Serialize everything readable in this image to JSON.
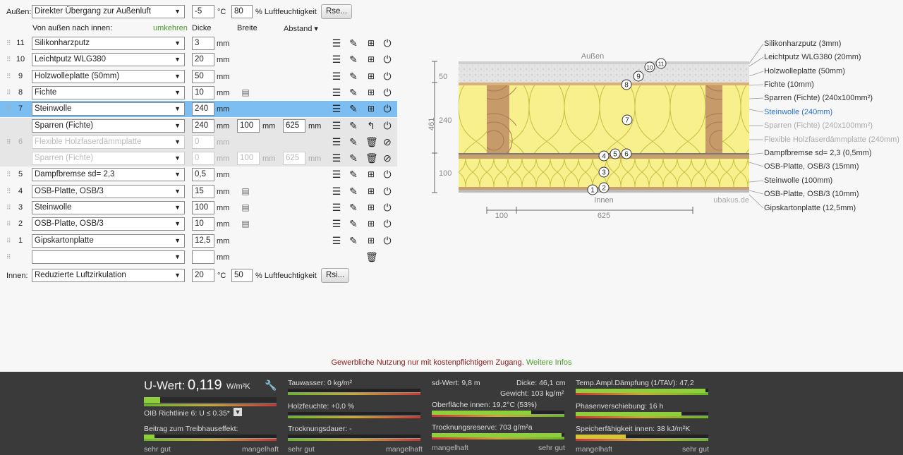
{
  "outside": {
    "label": "Außen:",
    "condition": "Direkter Übergang zur Außenluft",
    "temp": "-5",
    "temp_unit": "°C",
    "humidity": "80",
    "humidity_unit": "% Luftfeuchtigkeit",
    "rse_button": "Rse..."
  },
  "header": {
    "order_label": "Von außen nach innen:",
    "reverse_link": "umkehren",
    "col_thickness": "Dicke",
    "col_width": "Breite",
    "col_distance": "Abstand ▾"
  },
  "layers": [
    {
      "n": "11",
      "name": "Silikonharzputz",
      "d": "3",
      "unit": "mm"
    },
    {
      "n": "10",
      "name": "Leichtputz WLG380",
      "d": "20",
      "unit": "mm"
    },
    {
      "n": "9",
      "name": "Holzwolleplatte (50mm)",
      "d": "50",
      "unit": "mm"
    },
    {
      "n": "8",
      "name": "Fichte",
      "d": "10",
      "unit": "mm"
    },
    {
      "n": "7",
      "name": "Steinwolle",
      "d": "240",
      "unit": "mm"
    },
    {
      "n": "",
      "name": "Sparren (Fichte)",
      "d": "240",
      "unit": "mm",
      "w": "100",
      "wu": "mm",
      "a": "625",
      "au": "mm"
    },
    {
      "n": "6",
      "name": "Flexible Holzfaserdämmplatte",
      "d": "0",
      "unit": "mm"
    },
    {
      "n": "",
      "name": "Sparren (Fichte)",
      "d": "0",
      "unit": "mm",
      "w": "100",
      "wu": "mm",
      "a": "625",
      "au": "mm"
    },
    {
      "n": "5",
      "name": "Dampfbremse sd= 2,3",
      "d": "0,5",
      "unit": "mm"
    },
    {
      "n": "4",
      "name": "OSB-Platte, OSB/3",
      "d": "15",
      "unit": "mm"
    },
    {
      "n": "3",
      "name": "Steinwolle",
      "d": "100",
      "unit": "mm"
    },
    {
      "n": "2",
      "name": "OSB-Platte, OSB/3",
      "d": "10",
      "unit": "mm"
    },
    {
      "n": "1",
      "name": "Gipskartonplatte",
      "d": "12,5",
      "unit": "mm"
    },
    {
      "n": "",
      "name": "",
      "d": "",
      "unit": "mm"
    }
  ],
  "inside": {
    "label": "Innen:",
    "condition": "Reduzierte Luftzirkulation",
    "temp": "20",
    "temp_unit": "°C",
    "humidity": "50",
    "humidity_unit": "% Luftfeuchtigkeit",
    "rsi_button": "Rsi..."
  },
  "drawing": {
    "outside_label": "Außen",
    "inside_label": "Innen",
    "watermark": "ubakus.de",
    "dim_total": "461",
    "dim_top": "50",
    "dim_mid": "240",
    "dim_bot": "100",
    "dim_w1": "100",
    "dim_w2": "625",
    "legend": [
      {
        "text": "Silikonharzputz (3mm)",
        "style": "normal"
      },
      {
        "text": "Leichtputz WLG380 (20mm)",
        "style": "normal"
      },
      {
        "text": "Holzwolleplatte (50mm)",
        "style": "normal"
      },
      {
        "text": "Fichte (10mm)",
        "style": "normal"
      },
      {
        "text": "Sparren (Fichte) (240x100mm²)",
        "style": "normal"
      },
      {
        "text": "Steinwolle (240mm)",
        "style": "active"
      },
      {
        "text": "Sparren (Fichte) (240x100mm²)",
        "style": "disabled"
      },
      {
        "text": "Flexible Holzfaserdämmplatte (240mm)",
        "style": "disabled"
      },
      {
        "text": "Dampfbremse sd= 2,3 (0,5mm)",
        "style": "normal"
      },
      {
        "text": "OSB-Platte, OSB/3 (15mm)",
        "style": "normal"
      },
      {
        "text": "Steinwolle (100mm)",
        "style": "normal"
      },
      {
        "text": "OSB-Platte, OSB/3 (10mm)",
        "style": "normal"
      },
      {
        "text": "Gipskartonplatte (12,5mm)",
        "style": "normal"
      }
    ]
  },
  "notice": {
    "text": "Gewerbliche Nutzung nur mit kostenpflichtigem Zugang.",
    "link": "Weitere Infos"
  },
  "results": {
    "uwert_label": "U-Wert:",
    "uwert_value": "0,119",
    "uwert_unit": "W/m²K",
    "oib": "OIB Richtlinie 6: U ≤ 0.35*",
    "treibhaus": "Beitrag zum Treibhauseffekt:",
    "tauwasser": "Tauwasser: 0 kg/m²",
    "holzfeuchte": "Holzfeuchte: +0,0 %",
    "trocknung": "Trocknungsdauer: -",
    "sdwert": "sd-Wert: 9,8 m",
    "dicke": "Dicke: 46,1 cm",
    "gewicht": "Gewicht: 103 kg/m²",
    "oberflaeche": "Oberfläche innen: 19,2°C (53%)",
    "reserve": "Trocknungsreserve: 703 g/m²a",
    "tav": "Temp.Ampl.Dämpfung (1/TAV): 47,2",
    "phase": "Phasenverschiebung: 16 h",
    "speicher": "Speicherfähigkeit innen: 38 kJ/m²K",
    "good": "sehr gut",
    "bad": "mangelhaft",
    "levels": {
      "uwert": 0.12,
      "treibhaus": 0.08,
      "oberflaeche": 0.75,
      "reserve": 0.98,
      "tav": 0.98,
      "phase": 0.8,
      "speicher": 0.38
    }
  }
}
